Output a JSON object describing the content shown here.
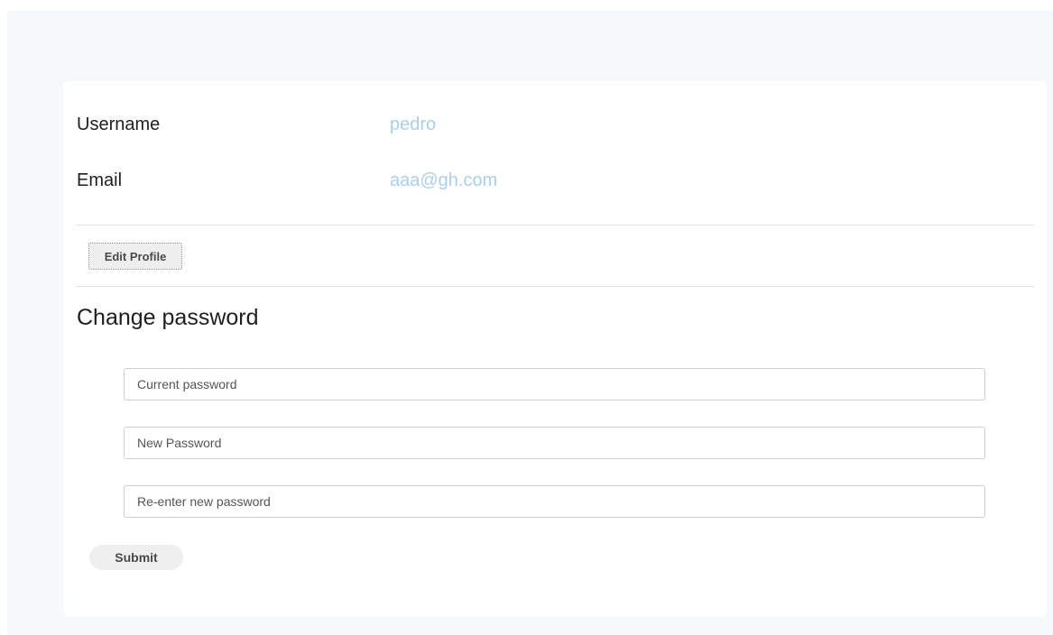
{
  "profile": {
    "username_label": "Username",
    "username_value": "pedro",
    "email_label": "Email",
    "email_value": "aaa@gh.com",
    "edit_button_label": "Edit Profile"
  },
  "change_password": {
    "title": "Change password",
    "current_placeholder": "Current password",
    "new_placeholder": "New Password",
    "reenter_placeholder": "Re-enter new password",
    "submit_label": "Submit"
  },
  "colors": {
    "page_background": "#f5f9fc",
    "value_accent": "#a9cfe9"
  }
}
